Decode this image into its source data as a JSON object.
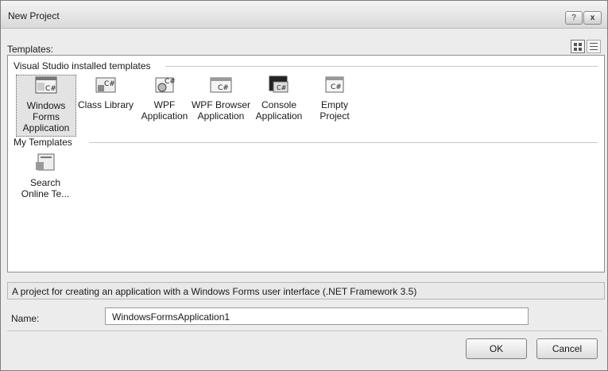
{
  "window": {
    "title": "New Project",
    "help_button": "?",
    "close_button": "x"
  },
  "templates_label": "Templates:",
  "groups": [
    {
      "label": "Visual Studio installed templates",
      "items": [
        {
          "label": "Windows Forms Application",
          "icon": "windows-forms-icon"
        },
        {
          "label": "Class Library",
          "icon": "class-library-icon"
        },
        {
          "label": "WPF Application",
          "icon": "wpf-application-icon"
        },
        {
          "label": "WPF Browser Application",
          "icon": "wpf-browser-application-icon"
        },
        {
          "label": "Console Application",
          "icon": "console-application-icon"
        },
        {
          "label": "Empty Project",
          "icon": "empty-project-icon"
        }
      ]
    },
    {
      "label": "My Templates",
      "items": [
        {
          "label": "Search Online Te...",
          "icon": "search-online-icon"
        }
      ]
    }
  ],
  "description": "A project for creating an application with a Windows Forms user interface (.NET Framework 3.5)",
  "name_label": "Name:",
  "name_value": "WindowsFormsApplication1",
  "buttons": {
    "ok": "OK",
    "cancel": "Cancel"
  }
}
